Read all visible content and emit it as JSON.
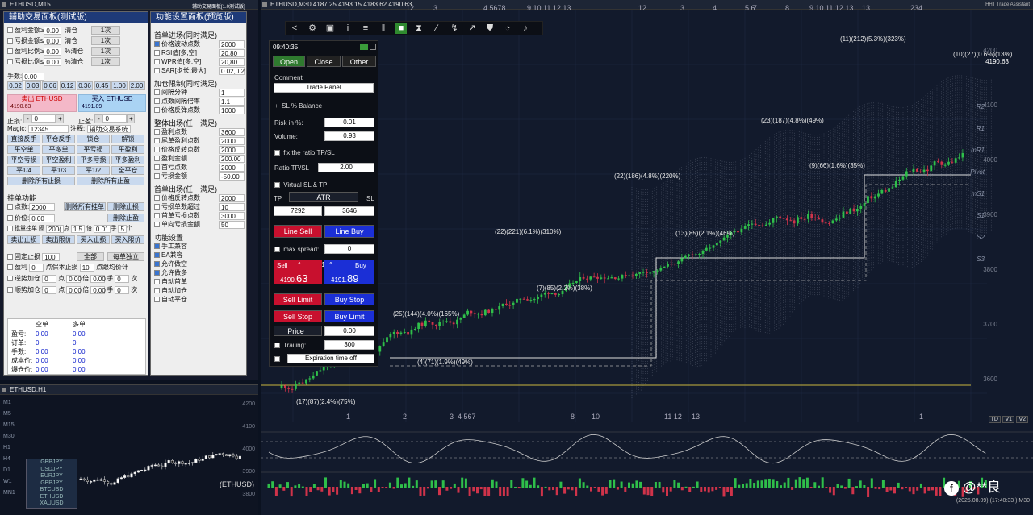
{
  "assist_window": {
    "title": "ETHUSD,M15"
  },
  "small_window": {
    "title": "ETHUSD,H1",
    "symbol_label": "(ETHUSD)",
    "y_ticks": [
      "4200",
      "4100",
      "4000",
      "3900",
      "3800"
    ],
    "tf_labels": [
      "M1",
      "M5",
      "M15",
      "M30",
      "H1",
      "H4",
      "D1",
      "W1",
      "MN1"
    ],
    "symbols": [
      "GBPJPY",
      "USDJPY",
      "EURJPY",
      "GBPJPY",
      "BTCUSD",
      "ETHUSD",
      "XAUUSD"
    ]
  },
  "trade_panel": {
    "title": "辅助交易面板(测试版)",
    "rows": [
      {
        "label": "盈利金额≥",
        "value": "0.00",
        "act": "清仓",
        "btn": "1次"
      },
      {
        "label": "亏损金额≤",
        "value": "0.00",
        "act": "清仓",
        "btn": "1次"
      },
      {
        "label": "盈利比例≥",
        "value": "0.00",
        "act": "%清仓",
        "btn": "1次"
      },
      {
        "label": "亏损比例≤",
        "value": "0.00",
        "act": "%清仓",
        "btn": "1次"
      }
    ],
    "lots_label": "手数:",
    "lots_value": "0.00",
    "lot_presets": [
      "0.02",
      "0.03",
      "0.06",
      "0.12",
      "0.36",
      "0.45",
      "1.00",
      "2.00"
    ],
    "sell_label": "卖出 ETHUSD",
    "sell_price": "4190.63",
    "buy_label": "买入 ETHUSD",
    "buy_price": "4191.89",
    "sl_label": "止损:",
    "sl_value": "0",
    "tp_label": "止盈:",
    "tp_value": "0",
    "magic_label": "Magic:",
    "magic_value": "12345",
    "note_label": "注释:",
    "note_value": "辅助交易系统",
    "actions": [
      "直接反手",
      "平仓反手",
      "锁仓",
      "解锁",
      "平空单",
      "平多单",
      "平亏损",
      "平盈利",
      "平空亏损",
      "平空盈利",
      "平多亏损",
      "平多盈利",
      "平1/4",
      "平1/3",
      "平1/2",
      "全平仓",
      "删除所有止损",
      "删除所有止盈"
    ],
    "pending_title": "挂单功能",
    "pending": {
      "points_label": "点数:",
      "points_value": "2000",
      "price_label": "价位:",
      "price_value": "0.00",
      "del_all": "删除所有挂单",
      "del_sl": "删除止损",
      "del_tp": "删除止盈",
      "batch_label": "批量挂单 隔",
      "batch_gap": "200(",
      "batch_pts": "点",
      "batch_lot": "1.5",
      "batch_mult_label": "倍",
      "batch_mult": "0.01",
      "batch_hands": "手",
      "batch_count": "5",
      "batch_unit": "个"
    },
    "pending_btns": [
      "卖出止损",
      "卖出限价",
      "买入止损",
      "买入限价"
    ],
    "fixed_label": "固定止损",
    "fixed_value": "100",
    "all_btn": "全部",
    "each_btn": "每单独立",
    "trail_label": "盈利",
    "trail_value": "0",
    "trail_mid": "点保本止损",
    "trail_pts": "10",
    "trail_right": "点跟均价计",
    "add1_label": "逆势加仓",
    "add2_label": "顺势加仓",
    "add_vals": [
      "0",
      "点",
      "0.00",
      "倍",
      "0.00",
      "手",
      "0",
      "次"
    ],
    "stats_headers": [
      "",
      "空单",
      "多单"
    ],
    "stats": [
      {
        "k": "盈亏:",
        "a": "0.00",
        "b": "0.00"
      },
      {
        "k": "订单:",
        "a": "0",
        "b": "0"
      },
      {
        "k": "手数:",
        "a": "0.00",
        "b": "0.00"
      },
      {
        "k": "成本价:",
        "a": "0.00",
        "b": "0.00"
      },
      {
        "k": "爆仓价:",
        "a": "0.00",
        "b": "0.00"
      }
    ]
  },
  "settings_panel": {
    "header_small": "辅助交易面板[1.0测试版]",
    "title": "功能设置面板(预览版)",
    "sec1": "首单进场(同时满足)",
    "sec1_rows": [
      {
        "on": true,
        "k": "价格波动点数",
        "v": "2000"
      },
      {
        "on": false,
        "k": "RSI值[多,空]",
        "v": "20,80"
      },
      {
        "on": false,
        "k": "WPR值[多,空]",
        "v": "20,80"
      },
      {
        "on": false,
        "k": "SAR[步长,最大]",
        "v": "0.02,0.2"
      }
    ],
    "sec2": "加仓限制(同时满足)",
    "sec2_rows": [
      {
        "k": "间隔分钟",
        "v": "1"
      },
      {
        "k": "点数间隔倍率",
        "v": "1.1"
      },
      {
        "k": "价格反弹点数",
        "v": "1000"
      }
    ],
    "sec3": "整体出场(任一满足)",
    "sec3_rows": [
      {
        "k": "盈利点数",
        "v": "3600"
      },
      {
        "k": "尾单盈利点数",
        "v": "2000"
      },
      {
        "k": "价格反转点数",
        "v": "2000"
      },
      {
        "k": "盈利金额",
        "v": "200.00"
      },
      {
        "k": "首亏点数",
        "v": "2000"
      },
      {
        "k": "亏损金额",
        "v": "-50.00"
      }
    ],
    "sec4": "首单出场(任一满足)",
    "sec4_rows": [
      {
        "k": "价格反转点数",
        "v": "2000"
      },
      {
        "k": "亏损单数超过",
        "v": "10"
      },
      {
        "k": "首单亏损点数",
        "v": "3000"
      },
      {
        "k": "单向亏损金额",
        "v": "50"
      }
    ],
    "sec5": "功能设置",
    "sec5_rows": [
      {
        "on": true,
        "k": "手工兼容"
      },
      {
        "on": true,
        "k": "EA兼容"
      },
      {
        "on": true,
        "k": "允许做空"
      },
      {
        "on": true,
        "k": "允许做多"
      },
      {
        "on": false,
        "k": "自动首单"
      },
      {
        "on": false,
        "k": "自动加仓"
      },
      {
        "on": false,
        "k": "自动平仓"
      }
    ]
  },
  "main_window": {
    "title": "ETHUSD,M30",
    "ohlc": "4187.25 4193.15 4183.62 4190.63",
    "assistant": "HHT Trade Assistant",
    "current_price": "4190.63",
    "date_label": "(2025.08.09) (17:40:33 )",
    "tf": "M30",
    "y_ticks": [
      "4200",
      "4100",
      "4000",
      "3900",
      "3800",
      "3700",
      "3600"
    ],
    "pivots": [
      "R2",
      "R1",
      "mR1",
      "Pivot",
      "mS1",
      "S1",
      "S2",
      "S3"
    ],
    "tabs": [
      "TD",
      "V1",
      "V2"
    ],
    "watermark": "@**良",
    "annotations": [
      "(11)(212)(5.3%)(323%)",
      "(10)(27)(0.6%)(13%)",
      "(23)(187)(4.8%)(49%)",
      "(22)(186)(4.8%)(220%)",
      "(9)(66)(1.6%)(35%)",
      "(13)(85)(2.1%)(46%)",
      "(22)(221)(6.1%)(310%)",
      "(7)(85)(2.2%)(38%)",
      "(25)(144)(4.0%)(165%)",
      "(4)(71)(1.9%)(49%)",
      "(17)(87)(2.4%)(75%)"
    ],
    "top_counts": [
      "12",
      "3",
      "4 5678",
      "9 10 11 12 13",
      "12",
      "3",
      "4",
      "5 6",
      "7",
      "8",
      "9 10 11 12 13",
      "13",
      "234"
    ],
    "bottom_counts": [
      "1",
      "2",
      "3",
      "4 567",
      "8",
      "10",
      "11 12",
      "13",
      "1"
    ]
  },
  "order_panel": {
    "time": "09:40:35",
    "tabs": [
      "Open",
      "Close",
      "Other"
    ],
    "comment_label": "Comment",
    "comment_value": "Trade Panel",
    "sl_balance": "SL % Balance",
    "risk_label": "Risk in %:",
    "risk_value": "0.01",
    "volume_label": "Volume:",
    "volume_value": "0.93",
    "fix_label": "fix the ratio TP/SL",
    "ratio_label": "Ratio TP/SL",
    "ratio_value": "2.00",
    "virtual_label": "Virtual SL & TP",
    "tp_label": "TP",
    "atr_label": "ATR",
    "sl_label": "SL",
    "tp_value": "7292",
    "sl_value": "3646",
    "line_sell": "Line Sell",
    "line_buy": "Line Buy",
    "max_spread": "max spread:",
    "spread_value": "0",
    "sell_label": "Sell",
    "buy_label": "Buy",
    "spread": "126",
    "sell_price_a": "4190.",
    "sell_price_b": "63",
    "buy_price_a": "4191.",
    "buy_price_b": "89",
    "sell_limit": "Sell Limit",
    "buy_stop": "Buy Stop",
    "sell_stop": "Sell Stop",
    "buy_limit": "Buy Limit",
    "price_label": "Price :",
    "price_value": "0.00",
    "trailing_label": "Trailing:",
    "trailing_value": "300",
    "expiration": "Expiration time off"
  },
  "colors": {
    "sell": "#c8102e",
    "buy": "#1b2fd6",
    "panel_blue": "#1e3a78",
    "chart_bg": "#121a2c",
    "bull": "#2fbf4a",
    "bear": "#d0334a"
  }
}
